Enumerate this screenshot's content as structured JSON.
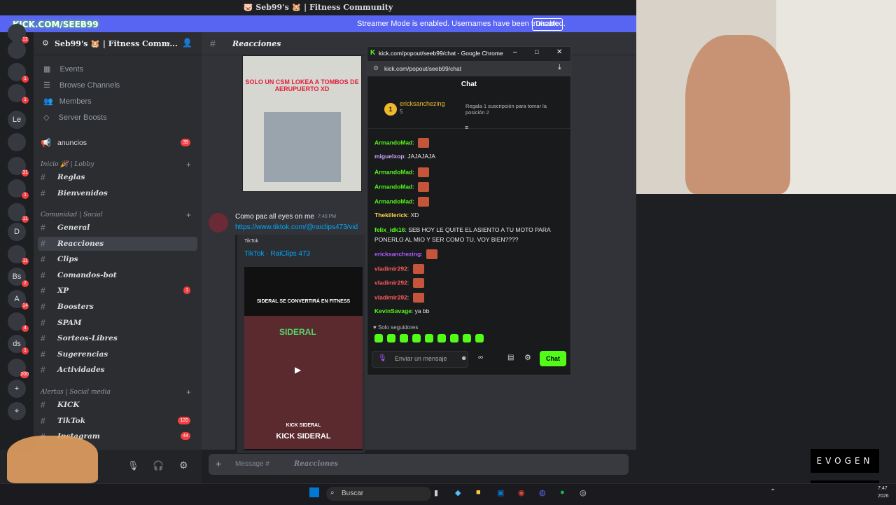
{
  "window": {
    "title": "🐷 Seb99's 🐹 | Fitness Community"
  },
  "streamer": {
    "message": "Streamer Mode is enabled. Usernames have been truncated.",
    "disable_label": "Disable",
    "overlay_label": "KICK.COM/SEEB99"
  },
  "rail": {
    "items": [
      {
        "label": "",
        "badge": "12"
      },
      {
        "label": "",
        "badge": ""
      },
      {
        "label": "",
        "badge": "1"
      },
      {
        "label": "",
        "badge": "1"
      },
      {
        "label": "Le",
        "badge": ""
      },
      {
        "label": "",
        "badge": ""
      },
      {
        "label": "",
        "badge": "31"
      },
      {
        "label": "",
        "badge": "1"
      },
      {
        "label": "",
        "badge": "11"
      },
      {
        "label": "D",
        "badge": ""
      },
      {
        "label": "",
        "badge": "11"
      },
      {
        "label": "Bs",
        "badge": "2"
      },
      {
        "label": "A",
        "badge": "14"
      },
      {
        "label": "",
        "badge": "4"
      },
      {
        "label": "ds",
        "badge": "1"
      },
      {
        "label": "",
        "badge": "200"
      }
    ]
  },
  "server": {
    "name": "Seb99's 🐹 | Fitness Comm...",
    "nav": [
      "Events",
      "Browse Channels",
      "Members",
      "Server Boosts"
    ]
  },
  "channels": {
    "top": {
      "name": "anuncios",
      "count": "35"
    },
    "cat1": "Inicio 🎉 | Lobby",
    "cat1_items": [
      {
        "name": "Reglas"
      },
      {
        "name": "Bienvenidos"
      }
    ],
    "cat2": "Comunidad | Social",
    "cat2_items": [
      {
        "name": "General",
        "count": ""
      },
      {
        "name": "Reacciones",
        "count": ""
      },
      {
        "name": "Clips",
        "count": ""
      },
      {
        "name": "Comandos-bot",
        "count": ""
      },
      {
        "name": "XP",
        "count": "1"
      },
      {
        "name": "Boosters",
        "count": ""
      },
      {
        "name": "SPAM",
        "count": ""
      },
      {
        "name": "Sorteos-Libres",
        "count": ""
      },
      {
        "name": "Sugerencias",
        "count": ""
      },
      {
        "name": "Actividades",
        "count": ""
      }
    ],
    "cat3": "Alertas | Social media",
    "cat3_items": [
      {
        "name": "KICK",
        "count": ""
      },
      {
        "name": "TikTok",
        "count": "120"
      },
      {
        "name": "Instagram",
        "count": "44"
      }
    ]
  },
  "chat": {
    "channel_name": "Reacciones",
    "image1_caption": "SOLO UN CSM LOKEA A TOMBOS DE AERUPUERTO XD",
    "message_author": "Como pac all eyes on me",
    "message_time": "7:40 PM",
    "message_link": "https://www.tiktok.com/@raiclips473/vid",
    "embed_provider": "TikTok",
    "embed_title": "TikTok · RaiClips 473",
    "video_caption": "SIDERAL SE CONVERTIRÁ EN FITNESS",
    "video_sticker": "SIDERAL",
    "video_footer_small": "KICK SIDERAL",
    "video_footer": "KICK SIDERAL",
    "composer_placeholder": "Message #",
    "composer_channel": "Reacciones"
  },
  "popout": {
    "window_title": "kick.com/popout/seeb99/chat - Google Chrome",
    "url": "kick.com/popout/seeb99/chat",
    "header": "Chat",
    "pinned_user": "ericksanchezing",
    "pinned_count": "5",
    "pinned_rank": "1",
    "pinned_note": "Regala 1 suscripción para tomar la posición 2",
    "messages": [
      {
        "user": "ArmandoMad",
        "text": "",
        "color": "#53fc18"
      },
      {
        "user": "miguelxop",
        "text": "JAJAJAJA",
        "color": "#c9a6ff"
      },
      {
        "user": "ArmandoMad",
        "text": "",
        "color": "#53fc18"
      },
      {
        "user": "ArmandoMad",
        "text": "",
        "color": "#53fc18"
      },
      {
        "user": "ArmandoMad",
        "text": "",
        "color": "#53fc18"
      },
      {
        "user": "Thekillerick",
        "text": "XD",
        "color": "#ffd54a"
      },
      {
        "user": "felix_idk16",
        "text": "SEB HOY LE QUITE EL ASIENTO A TU MOTO PARA",
        "color": "#53fc18"
      },
      {
        "user": "",
        "text": "PONERLO AL MIO Y SER COMO TU, VOY BIEN????",
        "color": "#ffffff"
      },
      {
        "user": "ericksanchezing",
        "text": "",
        "color": "#b05cff"
      },
      {
        "user": "vladimir292",
        "text": "",
        "color": "#ff5b5b"
      },
      {
        "user": "vladimir292",
        "text": "",
        "color": "#ff5b5b"
      },
      {
        "user": "vladimir292",
        "text": "",
        "color": "#ff5b5b"
      },
      {
        "user": "KevinSavage",
        "text": "ya bb",
        "color": "#53fc18"
      }
    ],
    "followers_only": "Solo seguidores",
    "input_placeholder": "Enviar un mensaje",
    "send_label": "Chat"
  },
  "overlay": {
    "brand": "EVOGEN"
  },
  "taskbar": {
    "search_placeholder": "Buscar",
    "time": "7:47",
    "date": "2026"
  }
}
